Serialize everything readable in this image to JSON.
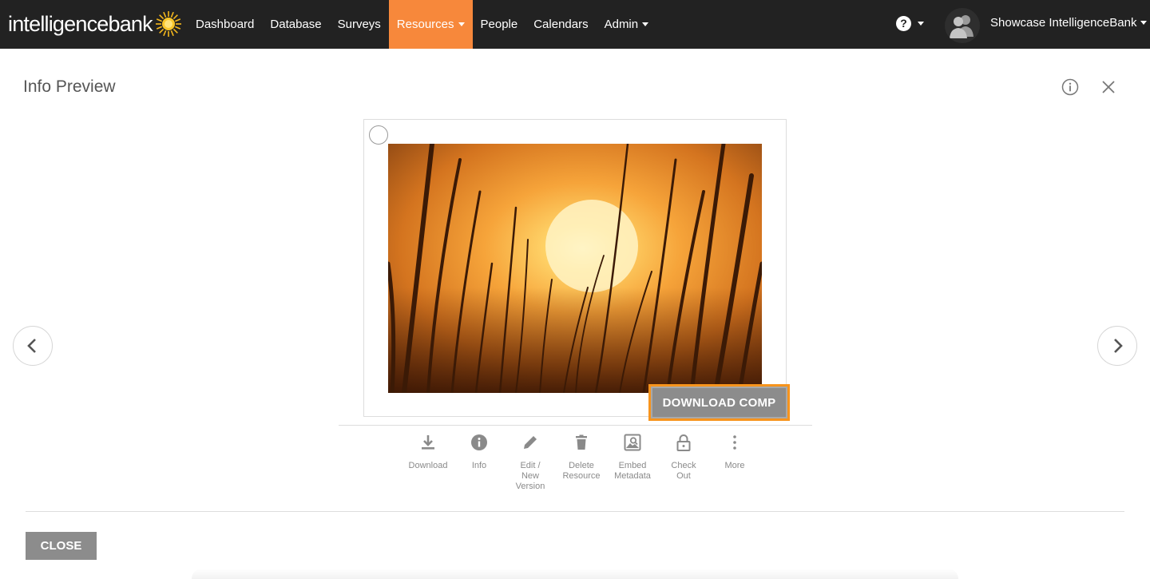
{
  "brand": {
    "logo_text": "intelligencebank",
    "accent": "#f7883b",
    "nav_bg": "#222222"
  },
  "nav": {
    "items": [
      {
        "label": "Dashboard",
        "active": false,
        "dropdown": false
      },
      {
        "label": "Database",
        "active": false,
        "dropdown": false
      },
      {
        "label": "Surveys",
        "active": false,
        "dropdown": false
      },
      {
        "label": "Resources",
        "active": true,
        "dropdown": true
      },
      {
        "label": "People",
        "active": false,
        "dropdown": false
      },
      {
        "label": "Calendars",
        "active": false,
        "dropdown": false
      },
      {
        "label": "Admin",
        "active": false,
        "dropdown": true
      }
    ],
    "help_icon": "?",
    "user_name": "Showcase IntelligenceBank"
  },
  "panel": {
    "title": "Info Preview",
    "download_comp_label": "DOWNLOAD COMP",
    "close_label": "CLOSE"
  },
  "actions": [
    {
      "icon": "download-icon",
      "label": "Download"
    },
    {
      "icon": "info-icon",
      "label": "Info"
    },
    {
      "icon": "pencil-icon",
      "label": "Edit /\nNew\nVersion"
    },
    {
      "icon": "trash-icon",
      "label": "Delete\nResource"
    },
    {
      "icon": "embed-metadata-icon",
      "label": "Embed\nMetadata"
    },
    {
      "icon": "lock-icon",
      "label": "Check\nOut"
    },
    {
      "icon": "more-vertical-icon",
      "label": "More"
    }
  ]
}
